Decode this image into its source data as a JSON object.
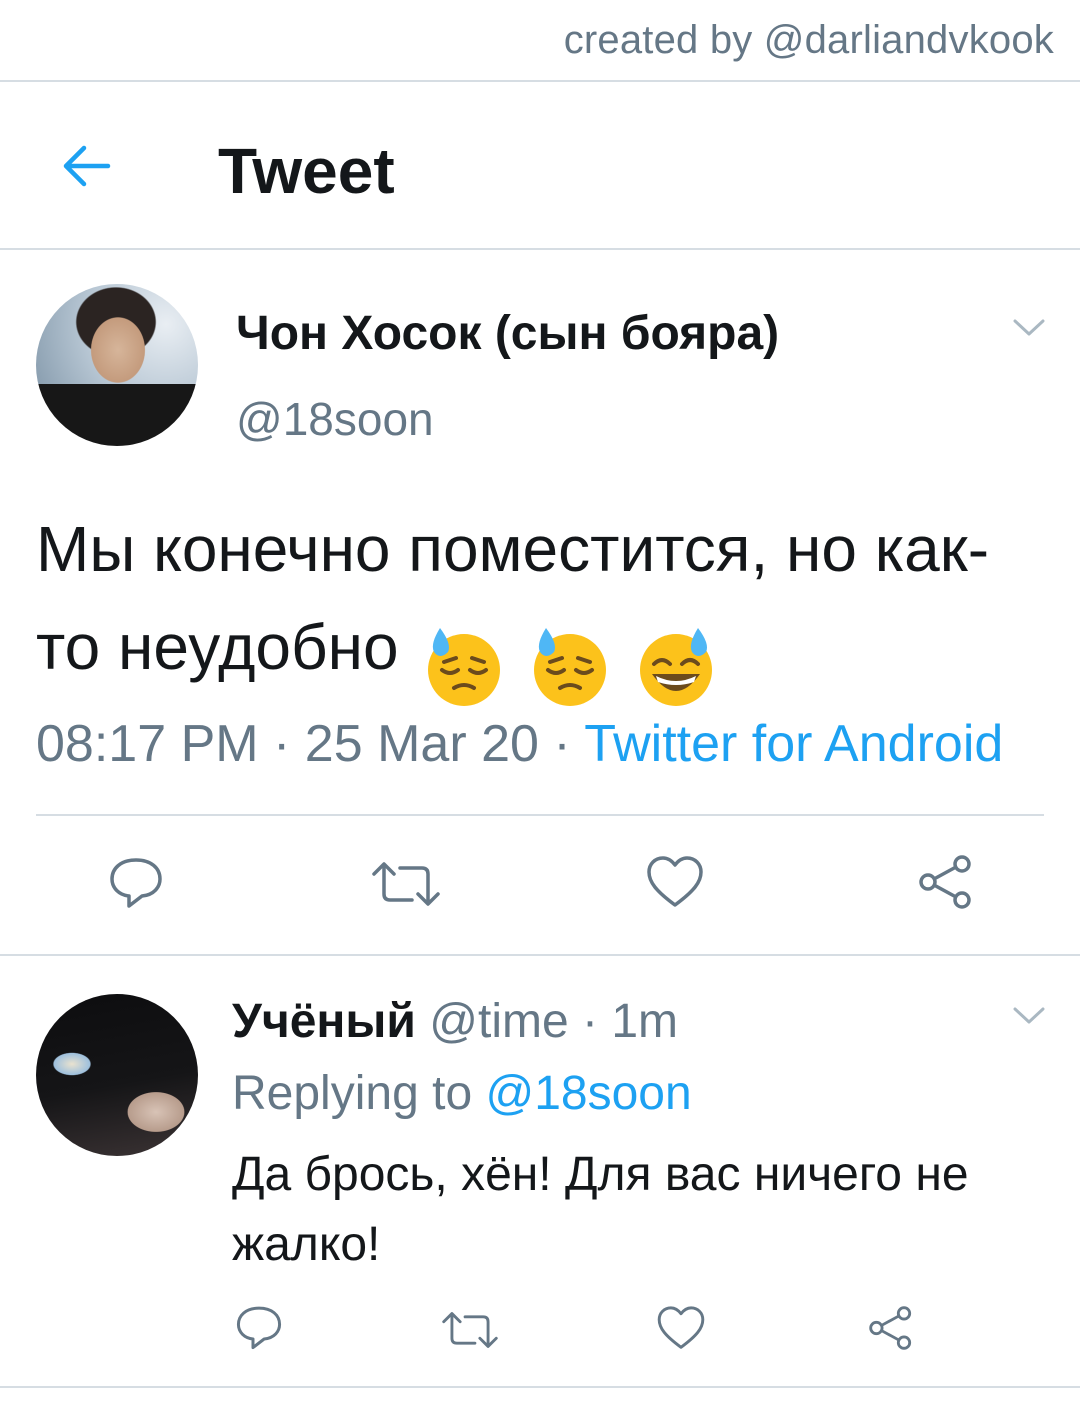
{
  "watermark": "created by @darliandvkook",
  "header": {
    "title": "Tweet",
    "back_icon": "arrow-left-icon"
  },
  "colors": {
    "accent": "#1da1f2",
    "muted": "#657786",
    "divider": "#d6dde3",
    "text": "#14171a"
  },
  "tweet": {
    "display_name": "Чон Хосок (сын бояра)",
    "handle": "@18soon",
    "text": "Мы конечно поместится, но как-то неудобно",
    "emojis": [
      "downcast-face-with-sweat",
      "downcast-face-with-sweat",
      "grinning-face-with-sweat"
    ],
    "time": "08:17 PM",
    "separator": " · ",
    "date": "25 Mar 20",
    "source": "Twitter for Android",
    "actions": [
      "reply-icon",
      "retweet-icon",
      "like-icon",
      "share-icon"
    ]
  },
  "reply": {
    "display_name": "Учёный",
    "handle": "@time",
    "separator": " · ",
    "age": "1m",
    "replying_label": "Replying to",
    "replying_to": "@18soon",
    "text": "Да брось, хён! Для вас ничего не жалко!",
    "actions": [
      "reply-icon",
      "retweet-icon",
      "like-icon",
      "share-icon"
    ]
  }
}
